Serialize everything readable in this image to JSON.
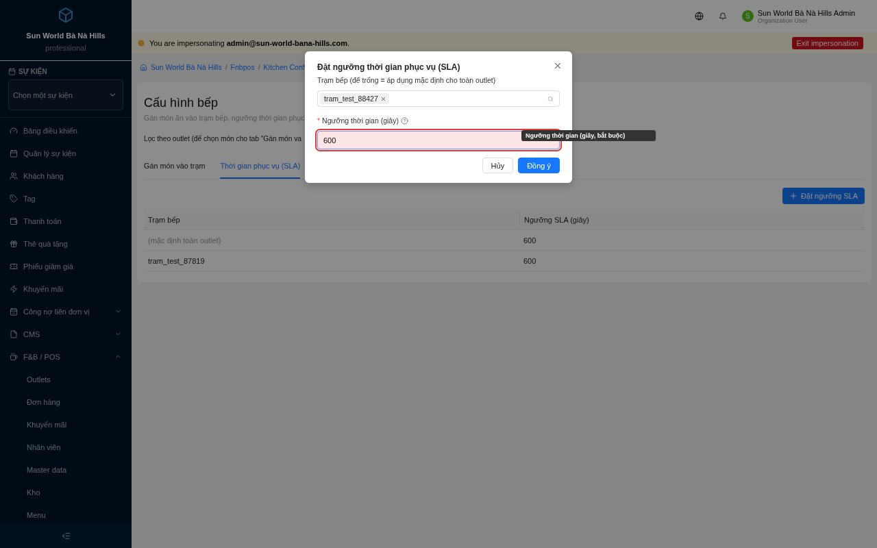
{
  "sidebar": {
    "brand": {
      "title": "Sun World Bà Nà Hills",
      "subtitle": "professional"
    },
    "event_section": {
      "label": "SỰ KIỆN",
      "select_placeholder": "Chọn một sự kiện"
    },
    "nav": [
      {
        "label": "Bảng điều khiển"
      },
      {
        "label": "Quản lý sự kiện"
      },
      {
        "label": "Khách hàng"
      },
      {
        "label": "Tag"
      },
      {
        "label": "Thanh toán"
      },
      {
        "label": "Thẻ quà tặng"
      },
      {
        "label": "Phiếu giảm giá"
      },
      {
        "label": "Khuyến mãi"
      },
      {
        "label": "Công nợ liên đơn vị",
        "expanded": false
      },
      {
        "label": "CMS",
        "expanded": false
      },
      {
        "label": "F&B / POS",
        "expanded": true,
        "children": [
          {
            "label": "Outlets"
          },
          {
            "label": "Đơn hàng"
          },
          {
            "label": "Khuyến mãi"
          },
          {
            "label": "Nhân viên"
          },
          {
            "label": "Master data"
          },
          {
            "label": "Kho"
          },
          {
            "label": "Menu"
          }
        ]
      }
    ]
  },
  "header": {
    "user": {
      "initial": "S",
      "name": "Sun World Bà Nà Hills Admin",
      "role": "Organization User"
    }
  },
  "banner": {
    "text": "You are impersonating **admin@sun-world-bana-hills.com**.",
    "button": "Exit impersonation"
  },
  "breadcrumb": {
    "separator": "/",
    "items": [
      "Sun World Bà Nà Hills",
      "Fnbpos",
      "Kitchen Conf"
    ]
  },
  "page": {
    "title": "Cấu hình bếp",
    "subtitle": "Gán món ăn vào trạm bếp, ngưỡng thời gian phục",
    "filter_label": "Lọc theo outlet (để chọn món cho tab \"Gán món va",
    "tabs": [
      {
        "label": "Gán món vào trạm",
        "selected": false
      },
      {
        "label": "Thời gian phục vụ (SLA)",
        "selected": true
      }
    ],
    "add_button": "Đặt ngưỡng SLA",
    "table": {
      "columns": [
        "Trạm bếp",
        "Ngưỡng SLA (giây)"
      ],
      "rows": [
        {
          "cells": [
            "(mặc định toàn outlet)",
            "600"
          ],
          "muted": true
        },
        {
          "cells": [
            "tram_test_87819",
            "600"
          ],
          "muted": false
        }
      ]
    }
  },
  "modal": {
    "title": "Đặt ngưỡng thời gian phục vụ (SLA)",
    "station_label": "Trạm bếp (để trống = áp dụng mặc định cho toàn outlet)",
    "station_tags": [
      {
        "label": "tram_test_88427"
      }
    ],
    "threshold_label": "Ngưỡng thời gian (giây)",
    "required_mark": "*",
    "threshold_value": "600",
    "threshold_invalid": true,
    "tooltip": "Ngưỡng thời gian (giây, bắt buộc)",
    "cancel_button": "Hủy",
    "ok_button": "Đồng ý"
  }
}
